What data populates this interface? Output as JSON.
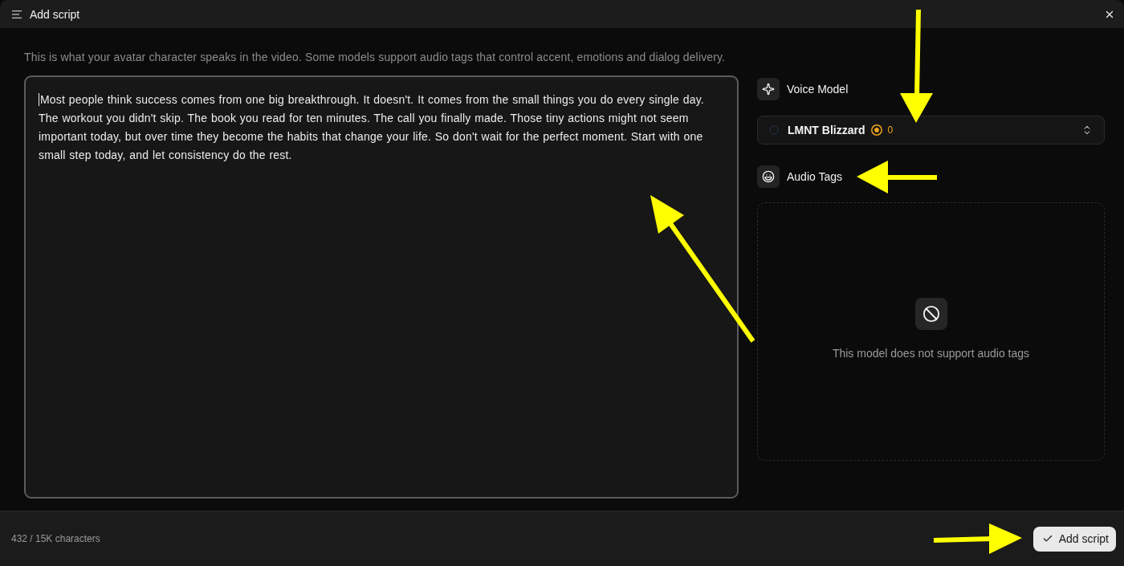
{
  "dialog": {
    "title": "Add script",
    "description": "This is what your avatar character speaks in the video. Some models support audio tags that control accent, emotions and dialog delivery.",
    "script": {
      "value": "Most people think success comes from one big breakthrough. It doesn't. It comes from the small things you do every single day. The workout you didn't skip. The book you read for ten minutes. The call you finally made. Those tiny actions might not seem important today, but over time they become the habits that change your life. So don't wait for the perfect moment. Start with one small step today, and let consistency do the rest.",
      "focused": true
    },
    "voice_model": {
      "heading": "Voice Model",
      "selected_model": "LMNT Blizzard",
      "credits": "0"
    },
    "audio_tags": {
      "heading": "Audio Tags",
      "empty_message": "This model does not support audio tags"
    },
    "footer": {
      "character_count": "432 / 15K characters",
      "submit_button": "Add script"
    }
  }
}
